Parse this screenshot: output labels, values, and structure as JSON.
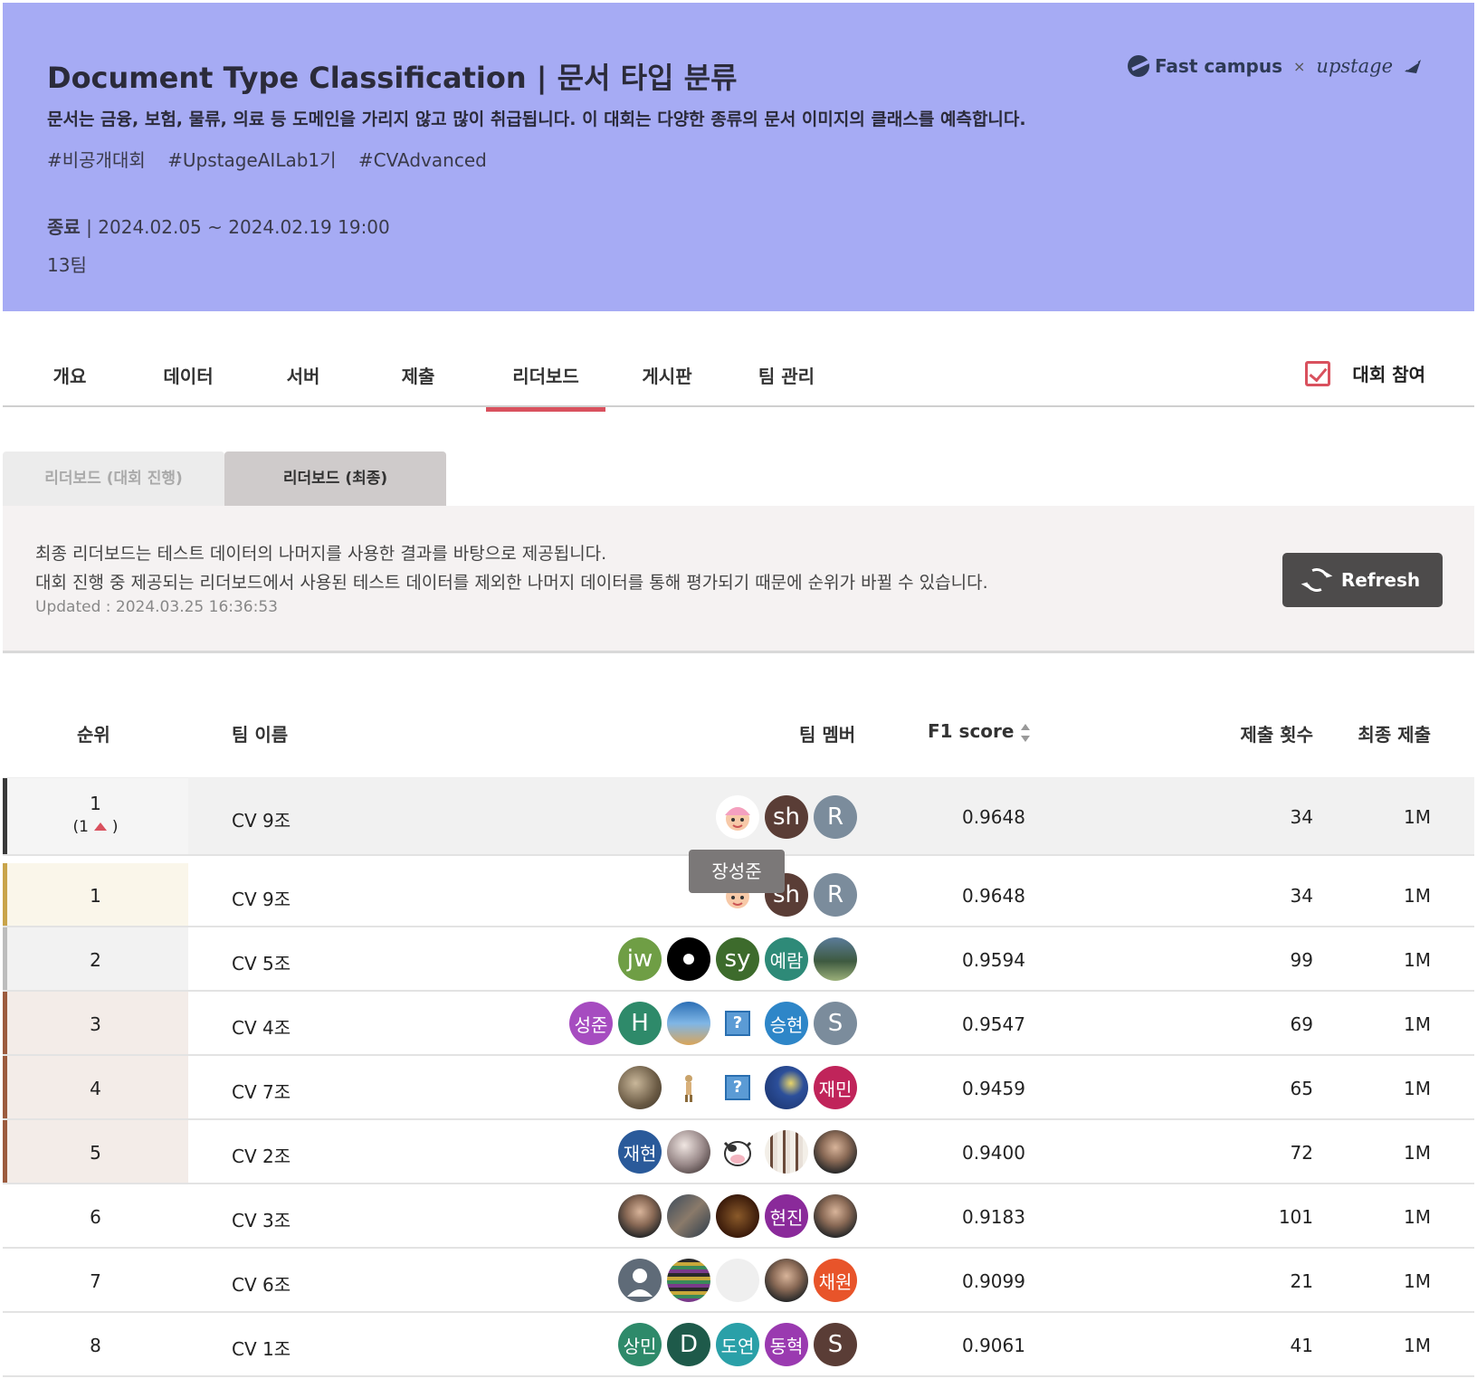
{
  "banner": {
    "title": "Document Type Classification | 문서 타입 분류",
    "description": "문서는 금융, 보험, 물류, 의료 등 도메인을 가리지 않고 많이 취급됩니다. 이 대회는 다양한 종류의 문서 이미지의 클래스를 예측합니다.",
    "tags": [
      "#비공개대회",
      "#UpstageAILab1기",
      "#CVAdvanced"
    ],
    "status_label": "종료",
    "period": " | 2024.02.05 ~ 2024.02.19 19:00",
    "teams_count": "13팀",
    "logo_fastcampus": "Fast campus",
    "logo_separator": "×",
    "logo_upstage": "upstage",
    "background_color": "#a6abf4"
  },
  "nav": {
    "tabs": [
      {
        "label": "개요",
        "active": false
      },
      {
        "label": "데이터",
        "active": false
      },
      {
        "label": "서버",
        "active": false
      },
      {
        "label": "제출",
        "active": false
      },
      {
        "label": "리더보드",
        "active": true
      },
      {
        "label": "게시판",
        "active": false
      },
      {
        "label": "팀 관리",
        "active": false
      }
    ],
    "join_label": "대회 참여",
    "join_checked": true,
    "accent_color": "#d9515e"
  },
  "leaderboard_tabs": [
    {
      "label": "리더보드 (대회 진행)",
      "active": false
    },
    {
      "label": "리더보드 (최종)",
      "active": true
    }
  ],
  "info": {
    "line1": "최종 리더보드는 테스트 데이터의 나머지를 사용한 결과를 바탕으로 제공됩니다.",
    "line2": "대회 진행 중 제공되는 리더보드에서 사용된 테스트 데이터를 제외한 나머지 데이터를 통해 평가되기 때문에 순위가 바뀔 수 있습니다.",
    "updated": "Updated : 2024.03.25 16:36:53",
    "refresh_label": "Refresh"
  },
  "table": {
    "headers": {
      "rank": "순위",
      "team_name": "팀 이름",
      "members": "팀 멤버",
      "f1": "F1 score",
      "submissions": "제출 횟수",
      "last_submission": "최종 제출"
    },
    "my_team": {
      "rank": "1",
      "change_open": "(1",
      "change_close": ")",
      "team": "CV 9조",
      "f1": "0.9648",
      "submissions": "34",
      "last": "1M",
      "members": [
        {
          "kind": "emoji-face",
          "text": ""
        },
        {
          "kind": "letter",
          "text": "sh",
          "color": "#5a3d36"
        },
        {
          "kind": "letter",
          "text": "R",
          "color": "#7b8c9c"
        }
      ]
    },
    "tooltip": "장성준",
    "rows": [
      {
        "rank": "1",
        "team": "CV 9조",
        "f1": "0.9648",
        "submissions": "34",
        "last": "1M",
        "members": [
          {
            "kind": "emoji-face",
            "text": ""
          },
          {
            "kind": "letter",
            "text": "sh",
            "color": "#5a3d36"
          },
          {
            "kind": "letter",
            "text": "R",
            "color": "#7b8c9c"
          }
        ]
      },
      {
        "rank": "2",
        "team": "CV 5조",
        "f1": "0.9594",
        "submissions": "99",
        "last": "1M",
        "members": [
          {
            "kind": "letter",
            "text": "jw",
            "color": "#6f9e45"
          },
          {
            "kind": "dot",
            "text": "",
            "color": "#000000"
          },
          {
            "kind": "letter",
            "text": "sy",
            "color": "#3d6b2c"
          },
          {
            "kind": "letter",
            "text": "예람",
            "color": "#2e8a78"
          },
          {
            "kind": "photo-landscape",
            "text": ""
          }
        ]
      },
      {
        "rank": "3",
        "team": "CV 4조",
        "f1": "0.9547",
        "submissions": "69",
        "last": "1M",
        "members": [
          {
            "kind": "letter",
            "text": "성준",
            "color": "#a64cc0"
          },
          {
            "kind": "letter",
            "text": "H",
            "color": "#2e8a6a"
          },
          {
            "kind": "photo-screen",
            "text": ""
          },
          {
            "kind": "unknown",
            "text": "?"
          },
          {
            "kind": "letter",
            "text": "승현",
            "color": "#2e86c8"
          },
          {
            "kind": "letter",
            "text": "S",
            "color": "#7b8c9c"
          }
        ]
      },
      {
        "rank": "4",
        "team": "CV 7조",
        "f1": "0.9459",
        "submissions": "65",
        "last": "1M",
        "members": [
          {
            "kind": "photo-bird",
            "text": ""
          },
          {
            "kind": "emoji-figure",
            "text": ""
          },
          {
            "kind": "unknown",
            "text": "?"
          },
          {
            "kind": "photo-starry",
            "text": ""
          },
          {
            "kind": "letter",
            "text": "재민",
            "color": "#c0245a"
          }
        ]
      },
      {
        "rank": "5",
        "team": "CV 2조",
        "f1": "0.9400",
        "submissions": "72",
        "last": "1M",
        "members": [
          {
            "kind": "letter",
            "text": "재현",
            "color": "#2a5a9a"
          },
          {
            "kind": "photo-planet",
            "text": ""
          },
          {
            "kind": "emoji-cow",
            "text": ""
          },
          {
            "kind": "photo-brushes",
            "text": ""
          },
          {
            "kind": "photo-person",
            "text": ""
          }
        ]
      },
      {
        "rank": "6",
        "team": "CV 3조",
        "f1": "0.9183",
        "submissions": "101",
        "last": "1M",
        "members": [
          {
            "kind": "photo-person",
            "text": ""
          },
          {
            "kind": "photo-group",
            "text": ""
          },
          {
            "kind": "photo-dark",
            "text": ""
          },
          {
            "kind": "letter",
            "text": "현진",
            "color": "#8a2a9a"
          },
          {
            "kind": "photo-person",
            "text": ""
          }
        ]
      },
      {
        "rank": "7",
        "team": "CV 6조",
        "f1": "0.9099",
        "submissions": "21",
        "last": "1M",
        "members": [
          {
            "kind": "default-user",
            "text": ""
          },
          {
            "kind": "photo-pixel",
            "text": ""
          },
          {
            "kind": "blank",
            "text": ""
          },
          {
            "kind": "photo-person",
            "text": ""
          },
          {
            "kind": "letter",
            "text": "채원",
            "color": "#e8542a"
          }
        ]
      },
      {
        "rank": "8",
        "team": "CV 1조",
        "f1": "0.9061",
        "submissions": "41",
        "last": "1M",
        "members": [
          {
            "kind": "letter",
            "text": "상민",
            "color": "#2e8a6a"
          },
          {
            "kind": "letter",
            "text": "D",
            "color": "#1e5a4a"
          },
          {
            "kind": "letter",
            "text": "도연",
            "color": "#2aa0a8"
          },
          {
            "kind": "letter",
            "text": "동혁",
            "color": "#9a3ab0"
          },
          {
            "kind": "letter",
            "text": "S",
            "color": "#5a3d36"
          }
        ]
      }
    ]
  }
}
